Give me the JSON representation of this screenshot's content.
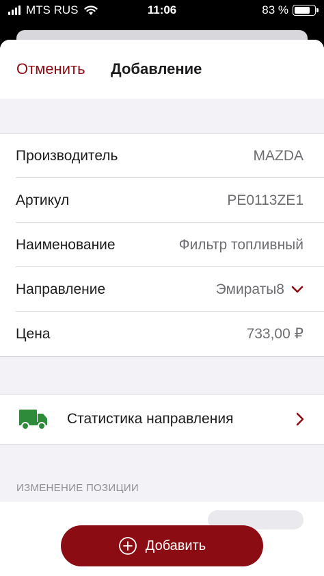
{
  "status_bar": {
    "carrier": "MTS RUS",
    "time": "11:06",
    "battery": "83 %"
  },
  "nav": {
    "cancel_label": "Отменить",
    "title": "Добавление"
  },
  "form": {
    "rows": [
      {
        "label": "Производитель",
        "value": "MAZDA"
      },
      {
        "label": "Артикул",
        "value": "PE0113ZE1"
      },
      {
        "label": "Наименование",
        "value": "Фильтр топливный"
      },
      {
        "label": "Направление",
        "value": "Эмираты8"
      },
      {
        "label": "Цена",
        "value": "733,00 ₽"
      }
    ]
  },
  "stats": {
    "label": "Статистика направления",
    "icon": "truck-icon"
  },
  "section": {
    "header": "ИЗМЕНЕНИЕ ПОЗИЦИИ"
  },
  "actions": {
    "add_label": "Добавить",
    "add_icon": "plus-circle-icon"
  },
  "colors": {
    "accent": "#8b0c13",
    "truck": "#2e8b3a",
    "background_gray": "#f2f2f7"
  }
}
